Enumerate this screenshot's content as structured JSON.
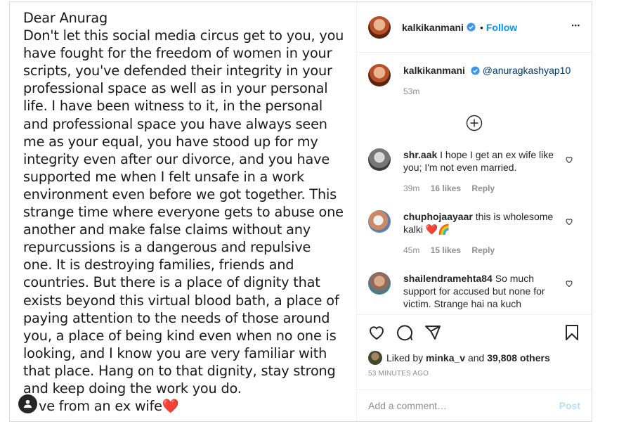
{
  "post": {
    "letter_lines": [
      "Dear Anurag",
      "Don't let this social media circus get to you, you",
      "have fought for the freedom of women in your",
      "scripts, you've defended their integrity in your",
      "professional space as well as in your personal",
      "life. I have been witness to it, in the personal",
      "and professional space you have always seen",
      "me as your equal, you have stood up for my",
      "integrity even after our divorce, and you have",
      "supported me when I felt unsafe in a work",
      "environment even before we got together. This",
      "strange time where everyone gets to abuse one",
      "another and make false claims without any",
      "repurcussions is a dangerous and repulsive",
      "one. It is destroying families, friends and",
      "countries. But there is a place of dignity that",
      "exists beyond this virtual blood bath, a place of",
      "paying attention to the needs of those around",
      "you, a place of being kind even when no one is",
      "looking, and I know you are very familiar with",
      "that place. Hang on to that dignity, stay strong",
      "and keep doing the work you do.",
      "ve from an ex wife❤️"
    ]
  },
  "header": {
    "username": "kalkikanmani",
    "separator": "•",
    "follow": "Follow",
    "more": "•••"
  },
  "caption": {
    "username": "kalkikanmani",
    "mention": "@anuragkashyap10",
    "time": "53m"
  },
  "comments": [
    {
      "username": "shr.aak",
      "text": "I hope I get an ex wife like you; I'm not even married.",
      "time": "39m",
      "likes": "16 likes",
      "reply": "Reply"
    },
    {
      "username": "chuphojaayaar",
      "text": "this is wholesome kalki ❤️🌈",
      "time": "45m",
      "likes": "15 likes",
      "reply": "Reply"
    },
    {
      "username": "shailendramehta84",
      "text": "So much support for accused but none for victim. Strange hai na kuch",
      "time": "",
      "likes": "",
      "reply": ""
    }
  ],
  "likes": {
    "prefix": "Liked by",
    "user": "minka_v",
    "middle": "and",
    "others": "39,808 others"
  },
  "timestamp": "53 MINUTES AGO",
  "add_comment": {
    "placeholder": "Add a comment…",
    "post_label": "Post"
  }
}
